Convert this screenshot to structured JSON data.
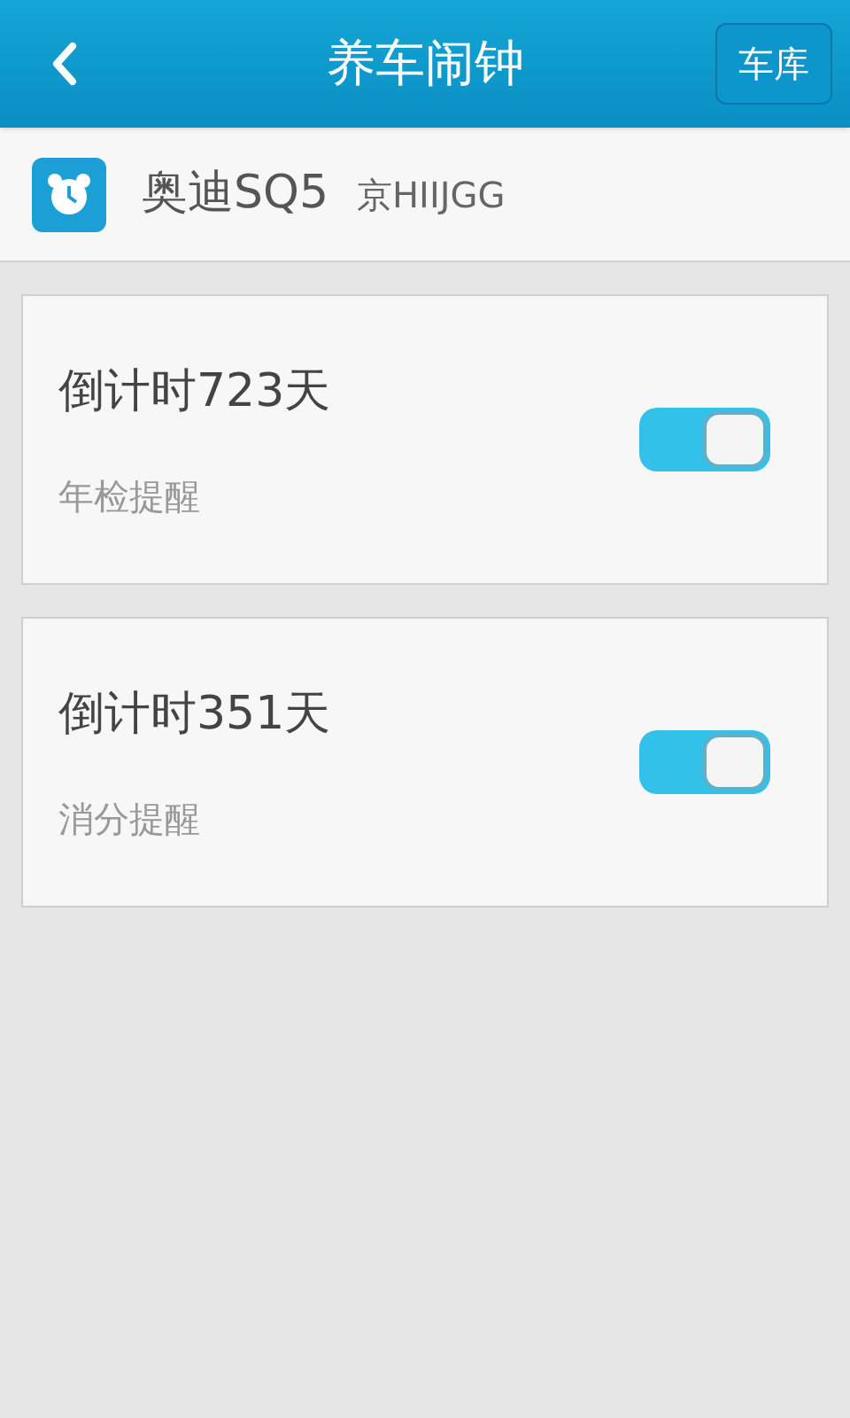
{
  "header": {
    "title": "养车闹钟",
    "garage_button": "车库"
  },
  "car": {
    "name": "奥迪SQ5",
    "plate": "京HIIJGG"
  },
  "reminders": [
    {
      "countdown": "倒计时723天",
      "label": "年检提醒",
      "on": true
    },
    {
      "countdown": "倒计时351天",
      "label": "消分提醒",
      "on": true
    }
  ]
}
